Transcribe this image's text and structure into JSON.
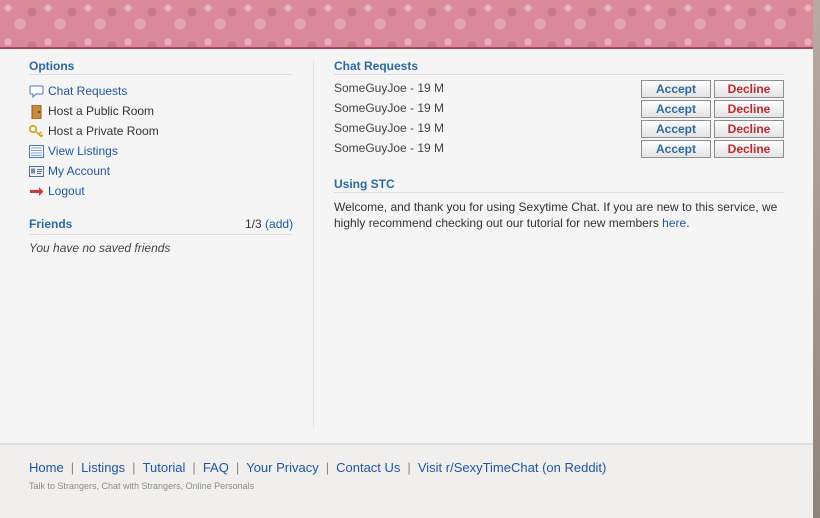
{
  "sidebar": {
    "options_title": "Options",
    "items": [
      {
        "label": "Chat Requests",
        "icon": "speech-bubble-icon"
      },
      {
        "label": "Host a Public Room",
        "icon": "door-icon"
      },
      {
        "label": "Host a Private Room",
        "icon": "key-icon"
      },
      {
        "label": "View Listings",
        "icon": "list-icon"
      },
      {
        "label": "My Account",
        "icon": "id-card-icon"
      },
      {
        "label": "Logout",
        "icon": "arrow-right-icon"
      }
    ],
    "friends": {
      "title": "Friends",
      "count": "1/3",
      "add_open": "(",
      "add_label": "add",
      "add_close": ")",
      "empty_text": "You have no saved friends"
    }
  },
  "main": {
    "requests_title": "Chat Requests",
    "requests": [
      {
        "name": "SomeGuyJoe - 19 M",
        "accept": "Accept",
        "decline": "Decline"
      },
      {
        "name": "SomeGuyJoe - 19 M",
        "accept": "Accept",
        "decline": "Decline"
      },
      {
        "name": "SomeGuyJoe - 19 M",
        "accept": "Accept",
        "decline": "Decline"
      },
      {
        "name": "SomeGuyJoe - 19 M",
        "accept": "Accept",
        "decline": "Decline"
      }
    ],
    "using_title": "Using STC",
    "welcome_text": "Welcome, and thank you for using Sexytime Chat. If you are new to this service, we highly recommend checking out our tutorial for new members ",
    "welcome_link": "here",
    "welcome_end": "."
  },
  "footer": {
    "links": [
      "Home",
      "Listings",
      "Tutorial",
      "FAQ",
      "Your Privacy",
      "Contact Us",
      "Visit r/SexyTimeChat (on Reddit)"
    ],
    "tagline": "Talk to Strangers, Chat with Strangers, Online Personals"
  },
  "colors": {
    "banner": "#d9899b",
    "title_blue": "#2c6aa0",
    "link_blue": "#2256a3",
    "decline_red": "#c0262e"
  }
}
